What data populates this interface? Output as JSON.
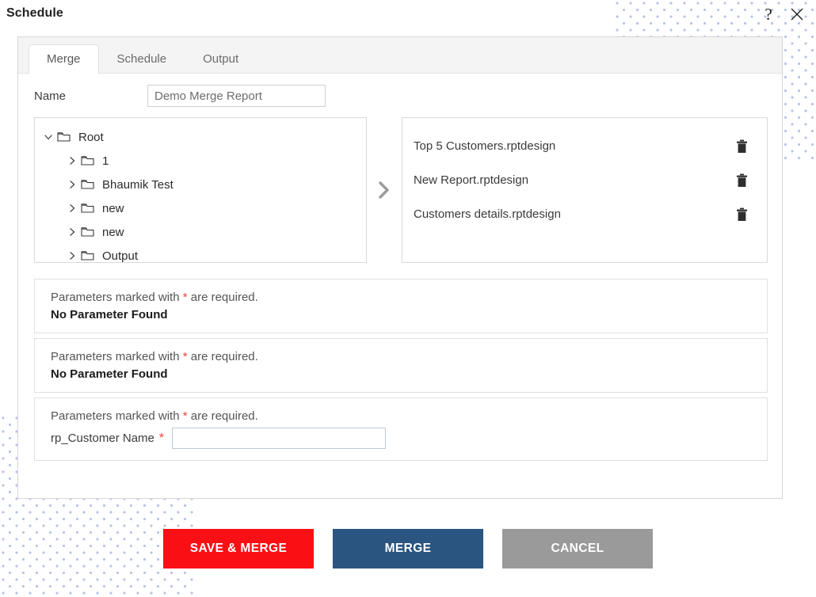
{
  "window": {
    "title": "Schedule",
    "help_icon": "question-mark-icon",
    "close_icon": "close-icon"
  },
  "tabs": [
    {
      "label": "Merge",
      "active": true
    },
    {
      "label": "Schedule",
      "active": false
    },
    {
      "label": "Output",
      "active": false
    }
  ],
  "form": {
    "name_label": "Name",
    "name_value": "Demo Merge Report",
    "name_placeholder": ""
  },
  "tree": {
    "nodes": [
      {
        "label": "Root",
        "expanded": true,
        "depth": 0
      },
      {
        "label": "1",
        "expanded": false,
        "depth": 1
      },
      {
        "label": "Bhaumik Test",
        "expanded": false,
        "depth": 1
      },
      {
        "label": "new",
        "expanded": false,
        "depth": 1
      },
      {
        "label": "new",
        "expanded": false,
        "depth": 1
      },
      {
        "label": "Output",
        "expanded": false,
        "depth": 1
      }
    ]
  },
  "transfer": {
    "arrow_icon": "chevron-right-icon"
  },
  "selected_reports": [
    {
      "name": "Top 5 Customers.rptdesign",
      "delete_icon": "trash-icon"
    },
    {
      "name": "New Report.rptdesign",
      "delete_icon": "trash-icon"
    },
    {
      "name": "Customers details.rptdesign",
      "delete_icon": "trash-icon"
    }
  ],
  "parameter_sections": [
    {
      "hint_before": "Parameters marked with ",
      "hint_asterisk": "*",
      "hint_after": " are required.",
      "status": "No Parameter Found",
      "fields": []
    },
    {
      "hint_before": "Parameters marked with ",
      "hint_asterisk": "*",
      "hint_after": " are required.",
      "status": "No Parameter Found",
      "fields": []
    },
    {
      "hint_before": "Parameters marked with ",
      "hint_asterisk": "*",
      "hint_after": " are required.",
      "status": "",
      "fields": [
        {
          "label": "rp_Customer Name",
          "required_mark": "*",
          "value": "",
          "placeholder": ""
        }
      ]
    }
  ],
  "footer": {
    "save_merge_label": "SAVE & MERGE",
    "merge_label": "MERGE",
    "cancel_label": "CANCEL"
  },
  "colors": {
    "save_merge": "#fa0f15",
    "merge": "#2a5580",
    "cancel": "#9a9a9a",
    "asterisk": "#e8443a",
    "dots": "#b9c2e8"
  }
}
